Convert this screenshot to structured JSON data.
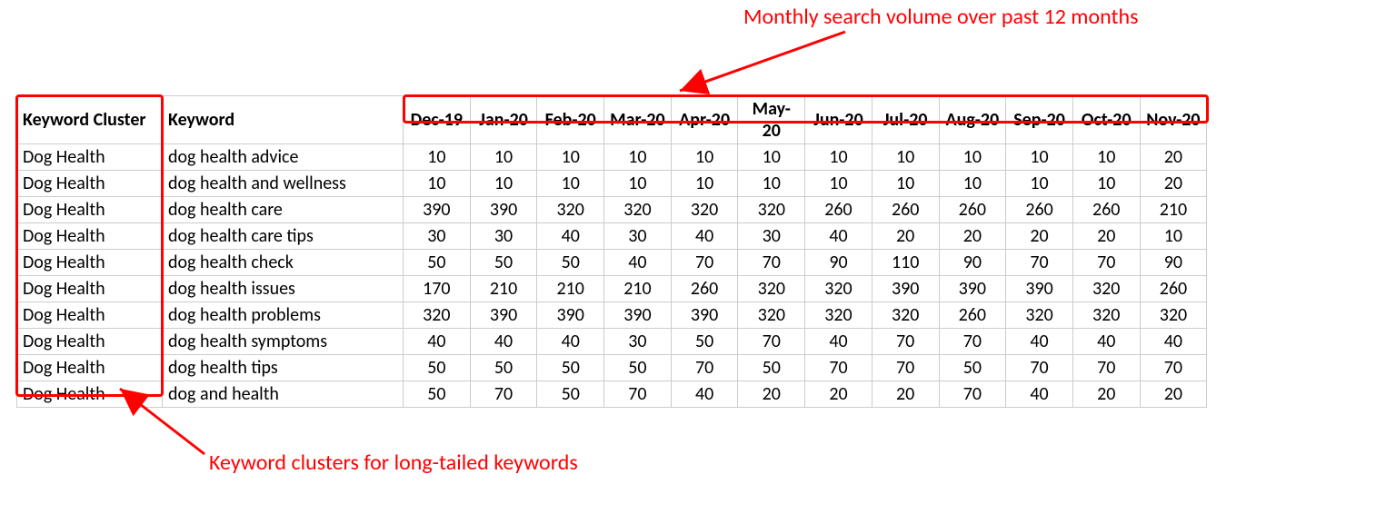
{
  "chart_data": {
    "type": "table",
    "title": "Monthly search volume over past 12 months",
    "columns": [
      "Keyword Cluster",
      "Keyword",
      "Dec-19",
      "Jan-20",
      "Feb-20",
      "Mar-20",
      "Apr-20",
      "May-20",
      "Jun-20",
      "Jul-20",
      "Aug-20",
      "Sep-20",
      "Oct-20",
      "Nov-20"
    ],
    "rows": [
      [
        "Dog Health",
        "dog health advice",
        10,
        10,
        10,
        10,
        10,
        10,
        10,
        10,
        10,
        10,
        10,
        20
      ],
      [
        "Dog Health",
        "dog health and wellness",
        10,
        10,
        10,
        10,
        10,
        10,
        10,
        10,
        10,
        10,
        10,
        20
      ],
      [
        "Dog Health",
        "dog health care",
        390,
        390,
        320,
        320,
        320,
        320,
        260,
        260,
        260,
        260,
        260,
        210
      ],
      [
        "Dog Health",
        "dog health care tips",
        30,
        30,
        40,
        30,
        40,
        30,
        40,
        20,
        20,
        20,
        20,
        10
      ],
      [
        "Dog Health",
        "dog health check",
        50,
        50,
        50,
        40,
        70,
        70,
        90,
        110,
        90,
        70,
        70,
        90
      ],
      [
        "Dog Health",
        "dog health issues",
        170,
        210,
        210,
        210,
        260,
        320,
        320,
        390,
        390,
        390,
        320,
        260
      ],
      [
        "Dog Health",
        "dog health problems",
        320,
        390,
        390,
        390,
        390,
        320,
        320,
        320,
        260,
        320,
        320,
        320
      ],
      [
        "Dog Health",
        "dog health symptoms",
        40,
        40,
        40,
        30,
        50,
        70,
        40,
        70,
        70,
        40,
        40,
        40
      ],
      [
        "Dog Health",
        "dog health tips",
        50,
        50,
        50,
        50,
        70,
        50,
        70,
        70,
        50,
        70,
        70,
        70
      ],
      [
        "Dog Health",
        "dog and health",
        50,
        70,
        50,
        70,
        40,
        20,
        20,
        20,
        70,
        40,
        20,
        20
      ]
    ]
  },
  "table": {
    "headers": {
      "cluster": "Keyword Cluster",
      "keyword": "Keyword",
      "months": [
        "Dec-19",
        "Jan-20",
        "Feb-20",
        "Mar-20",
        "Apr-20",
        "May-20",
        "Jun-20",
        "Jul-20",
        "Aug-20",
        "Sep-20",
        "Oct-20",
        "Nov-20"
      ]
    },
    "rows": [
      {
        "cluster": "Dog Health",
        "keyword": "dog health advice",
        "values": [
          "10",
          "10",
          "10",
          "10",
          "10",
          "10",
          "10",
          "10",
          "10",
          "10",
          "10",
          "20"
        ]
      },
      {
        "cluster": "Dog Health",
        "keyword": "dog health and wellness",
        "values": [
          "10",
          "10",
          "10",
          "10",
          "10",
          "10",
          "10",
          "10",
          "10",
          "10",
          "10",
          "20"
        ]
      },
      {
        "cluster": "Dog Health",
        "keyword": "dog health care",
        "values": [
          "390",
          "390",
          "320",
          "320",
          "320",
          "320",
          "260",
          "260",
          "260",
          "260",
          "260",
          "210"
        ]
      },
      {
        "cluster": "Dog Health",
        "keyword": "dog health care tips",
        "values": [
          "30",
          "30",
          "40",
          "30",
          "40",
          "30",
          "40",
          "20",
          "20",
          "20",
          "20",
          "10"
        ]
      },
      {
        "cluster": "Dog Health",
        "keyword": "dog health check",
        "values": [
          "50",
          "50",
          "50",
          "40",
          "70",
          "70",
          "90",
          "110",
          "90",
          "70",
          "70",
          "90"
        ]
      },
      {
        "cluster": "Dog Health",
        "keyword": "dog health issues",
        "values": [
          "170",
          "210",
          "210",
          "210",
          "260",
          "320",
          "320",
          "390",
          "390",
          "390",
          "320",
          "260"
        ]
      },
      {
        "cluster": "Dog Health",
        "keyword": "dog health problems",
        "values": [
          "320",
          "390",
          "390",
          "390",
          "390",
          "320",
          "320",
          "320",
          "260",
          "320",
          "320",
          "320"
        ]
      },
      {
        "cluster": "Dog Health",
        "keyword": "dog health symptoms",
        "values": [
          "40",
          "40",
          "40",
          "30",
          "50",
          "70",
          "40",
          "70",
          "70",
          "40",
          "40",
          "40"
        ]
      },
      {
        "cluster": "Dog Health",
        "keyword": "dog health tips",
        "values": [
          "50",
          "50",
          "50",
          "50",
          "70",
          "50",
          "70",
          "70",
          "50",
          "70",
          "70",
          "70"
        ]
      },
      {
        "cluster": "Dog Health",
        "keyword": "dog and health",
        "values": [
          "50",
          "70",
          "50",
          "70",
          "40",
          "20",
          "20",
          "20",
          "70",
          "40",
          "20",
          "20"
        ]
      }
    ]
  },
  "annotations": {
    "top_label": "Monthly search volume over past 12 months",
    "bottom_label": "Keyword clusters for long-tailed keywords"
  }
}
